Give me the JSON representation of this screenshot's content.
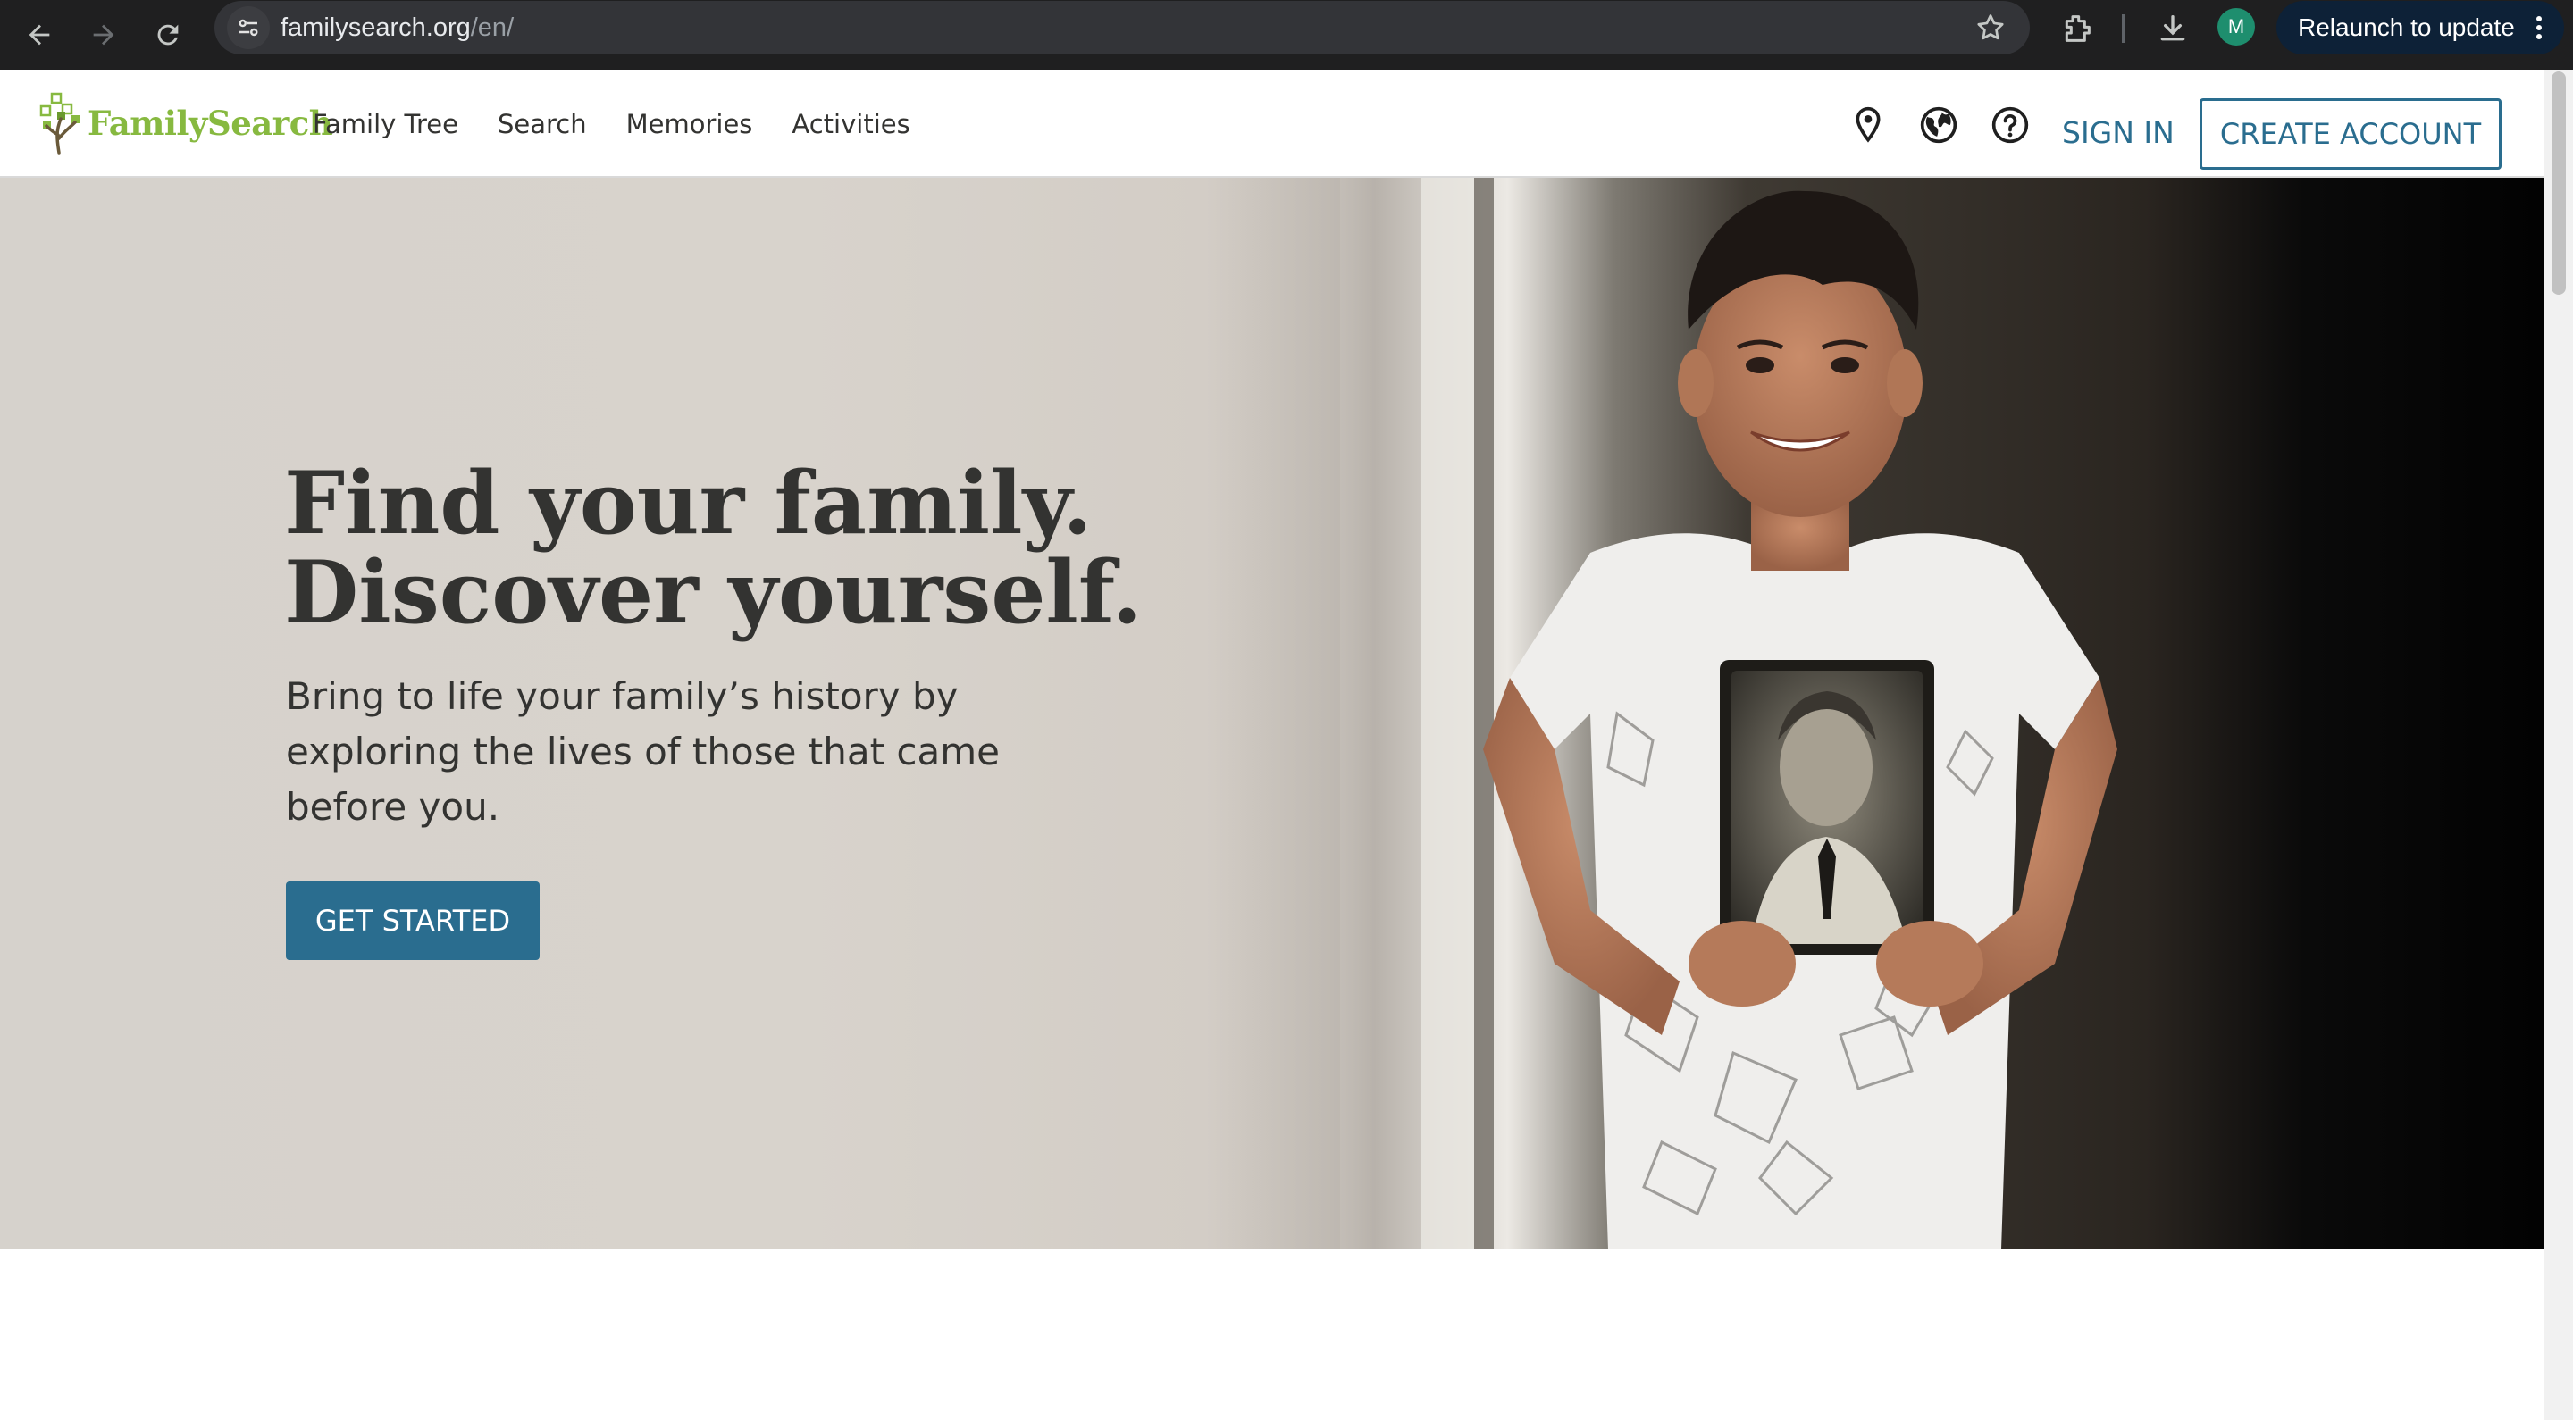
{
  "browser": {
    "url_host": "familysearch.org",
    "url_path": "/en/",
    "profile_initial": "M",
    "relaunch_label": "Relaunch to update",
    "icons": [
      "back-icon",
      "forward-icon",
      "reload-icon",
      "site-info-icon",
      "star-icon",
      "extensions-icon",
      "download-icon",
      "more-icon"
    ]
  },
  "header": {
    "logo_text": "FamilySearch",
    "nav": [
      "Family Tree",
      "Search",
      "Memories",
      "Activities"
    ],
    "icons": [
      "location-pin-icon",
      "globe-icon",
      "help-icon"
    ],
    "sign_in": "SIGN IN",
    "create_account": "CREATE ACCOUNT"
  },
  "hero": {
    "title_line1": "Find your family.",
    "title_line2": "Discover yourself.",
    "subtitle": "Bring to life your family’s history by exploring the lives of those that came before you.",
    "cta": "GET STARTED"
  },
  "colors": {
    "brand_green": "#87b940",
    "accent_blue": "#2a6d8f",
    "hero_background": "#d6d1cb",
    "text_dark": "#333331"
  }
}
